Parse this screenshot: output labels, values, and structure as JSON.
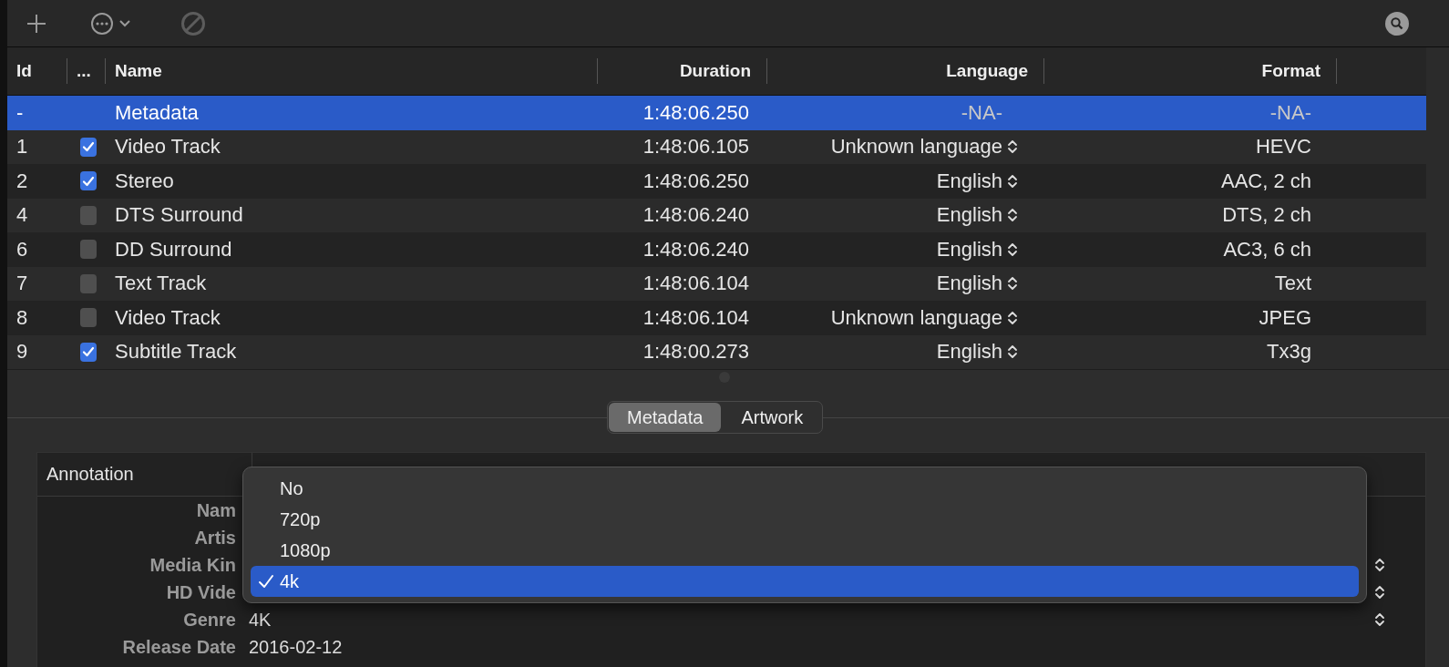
{
  "table": {
    "columns": [
      "Id",
      "...",
      "Name",
      "Duration",
      "Language",
      "Format"
    ],
    "rows": [
      {
        "kind": "metadata",
        "selected": true,
        "id": "-",
        "name": "Metadata",
        "duration": "1:48:06.250",
        "language": "-NA-",
        "format": "-NA-"
      },
      {
        "kind": "track",
        "selected": false,
        "checked": true,
        "id": "1",
        "name": "Video Track",
        "duration": "1:48:06.105",
        "language": "Unknown language",
        "format": "HEVC"
      },
      {
        "kind": "track",
        "selected": false,
        "checked": true,
        "id": "2",
        "name": "Stereo",
        "duration": "1:48:06.250",
        "language": "English",
        "format": "AAC, 2 ch"
      },
      {
        "kind": "track",
        "selected": false,
        "checked": false,
        "id": "4",
        "name": "DTS Surround",
        "duration": "1:48:06.240",
        "language": "English",
        "format": "DTS, 2 ch"
      },
      {
        "kind": "track",
        "selected": false,
        "checked": false,
        "id": "6",
        "name": "DD Surround",
        "duration": "1:48:06.240",
        "language": "English",
        "format": "AC3, 6 ch"
      },
      {
        "kind": "track",
        "selected": false,
        "checked": false,
        "id": "7",
        "name": "Text Track",
        "duration": "1:48:06.104",
        "language": "English",
        "format": "Text"
      },
      {
        "kind": "track",
        "selected": false,
        "checked": false,
        "id": "8",
        "name": "Video Track",
        "duration": "1:48:06.104",
        "language": "Unknown language",
        "format": "JPEG"
      },
      {
        "kind": "track",
        "selected": false,
        "checked": true,
        "id": "9",
        "name": "Subtitle Track",
        "duration": "1:48:00.273",
        "language": "English",
        "format": "Tx3g"
      }
    ]
  },
  "tabs": [
    {
      "label": "Metadata",
      "selected": true
    },
    {
      "label": "Artwork",
      "selected": false
    }
  ],
  "metadata": {
    "column": "Annotation",
    "rows": [
      {
        "label": "Nam",
        "kind": "text"
      },
      {
        "label": "Artis",
        "kind": "text"
      },
      {
        "label": "Media Kin",
        "kind": "popup"
      },
      {
        "label": "HD Vide",
        "kind": "popup"
      },
      {
        "label": "Genre",
        "kind": "popup",
        "value": "4K"
      },
      {
        "label": "Release Date",
        "kind": "text",
        "value": "2016-02-12"
      }
    ]
  },
  "popup_menu": {
    "items": [
      {
        "label": "No",
        "selected": false
      },
      {
        "label": "720p",
        "selected": false
      },
      {
        "label": "1080p",
        "selected": false
      },
      {
        "label": "4k",
        "selected": true
      }
    ]
  }
}
